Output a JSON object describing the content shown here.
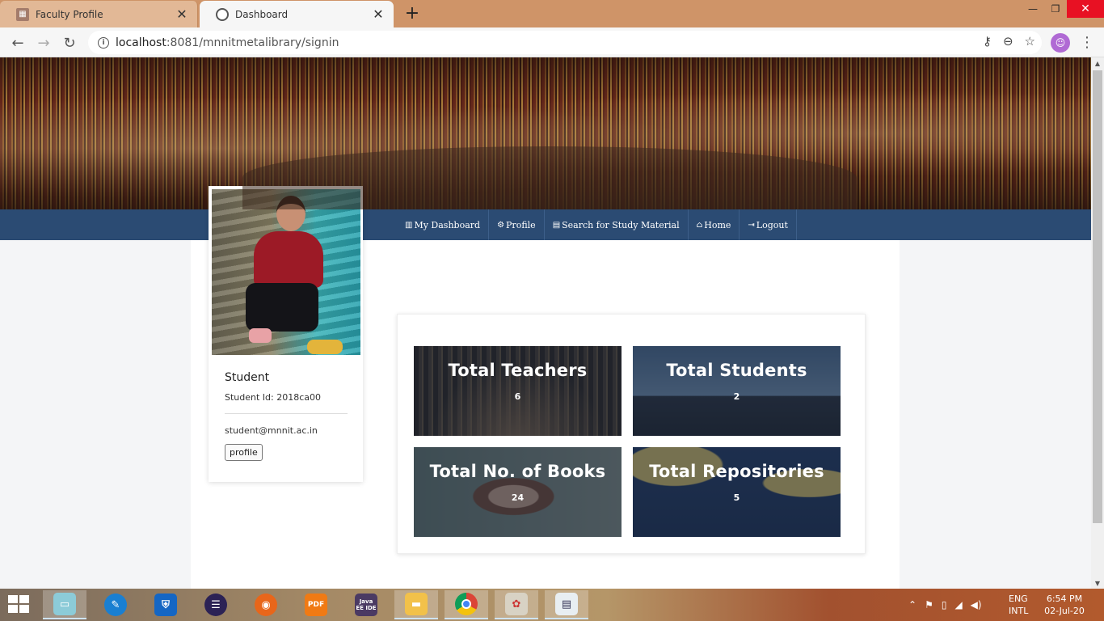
{
  "browser": {
    "tabs": [
      {
        "title": "Faculty Profile",
        "close": "✕"
      },
      {
        "title": "Dashboard",
        "close": "✕"
      }
    ],
    "new_tab": "+",
    "window_controls": {
      "minimize": "—",
      "maximize": "❐",
      "close": "✕"
    },
    "url_host": "localhost",
    "url_path": ":8081/mnnitmetalibrary/signin",
    "icons": [
      "back-icon",
      "forward-icon",
      "reload-icon",
      "info-icon",
      "key-icon",
      "zoom-out-icon",
      "star-icon",
      "profile-avatar-icon",
      "menu-icon"
    ]
  },
  "navbar": {
    "items": [
      {
        "icon": "bar-chart-icon",
        "glyph": "▥",
        "label": "My Dashboard"
      },
      {
        "icon": "gears-icon",
        "glyph": "⚙",
        "label": "Profile"
      },
      {
        "icon": "book-icon",
        "glyph": "▤",
        "label": "Search for Study Material"
      },
      {
        "icon": "home-icon",
        "glyph": "⌂",
        "label": "Home"
      },
      {
        "icon": "logout-icon",
        "glyph": "⇥",
        "label": "Logout"
      }
    ]
  },
  "profile": {
    "name": "Student",
    "student_id": "Student Id: 2018ca00",
    "email": "student@mnnit.ac.in",
    "button": "profile"
  },
  "stats": [
    {
      "title": "Total Teachers",
      "value": "6"
    },
    {
      "title": "Total Students",
      "value": "2"
    },
    {
      "title": "Total No. of Books",
      "value": "24"
    },
    {
      "title": "Total Repositories",
      "value": "5"
    }
  ],
  "taskbar": {
    "apps": [
      "file-explorer-icon",
      "settings-tool-icon",
      "windows-defender-icon",
      "eclipse-icon",
      "firefox-icon",
      "pdf-reader-icon",
      "java-ee-ide-icon",
      "folder-icon",
      "chrome-icon",
      "paint-icon",
      "notepad-icon"
    ],
    "java_label": "Java EE IDE",
    "pdf_label": "PDF",
    "lang_line1": "ENG",
    "lang_line2": "INTL",
    "time": "6:54 PM",
    "date": "02-Jul-20"
  }
}
